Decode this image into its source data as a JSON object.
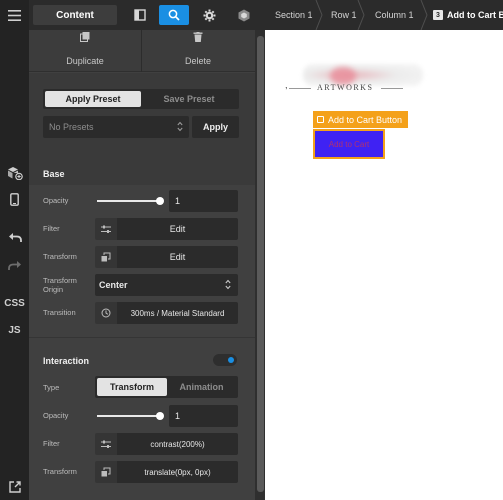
{
  "topbar": {
    "content_tab": "Content"
  },
  "leftbar": {
    "css_label": "CSS",
    "js_label": "JS"
  },
  "panel": {
    "duplicate_label": "Duplicate",
    "delete_label": "Delete",
    "apply_preset_label": "Apply Preset",
    "save_preset_label": "Save Preset",
    "presets_select": "No Presets",
    "apply_label": "Apply",
    "base": {
      "title": "Base",
      "opacity_label": "Opacity",
      "opacity_value": "1",
      "opacity_level": 1.0,
      "filter_label": "Filter",
      "filter_value": "Edit",
      "transform_label": "Transform",
      "transform_value": "Edit",
      "origin_label_1": "Transform",
      "origin_label_2": "Origin",
      "origin_value": "Center",
      "transition_label": "Transition",
      "transition_value": "300ms / Material Standard"
    },
    "interaction": {
      "title": "Interaction",
      "toggle_on": true,
      "type_label": "Type",
      "type_transform": "Transform",
      "type_animation": "Animation",
      "opacity_label": "Opacity",
      "opacity_value": "1",
      "opacity_level": 1.0,
      "filter_label": "Filter",
      "filter_value": "contrast(200%)",
      "transform_label": "Transform",
      "transform_value": "translate(0px, 0px)"
    }
  },
  "breadcrumb": {
    "items": [
      "Section 1",
      "Row 1",
      "Column 1"
    ],
    "current_number": "3",
    "current_label": "Add to Cart B..."
  },
  "canvas": {
    "logo_text": "ARTWORKS",
    "selected_label": "Add to Cart Button",
    "button_text": "Add to Cart"
  },
  "colors": {
    "accent": "#1a8fe3",
    "selection": "#f4a11a",
    "cart_button_bg": "#3f22f3"
  }
}
